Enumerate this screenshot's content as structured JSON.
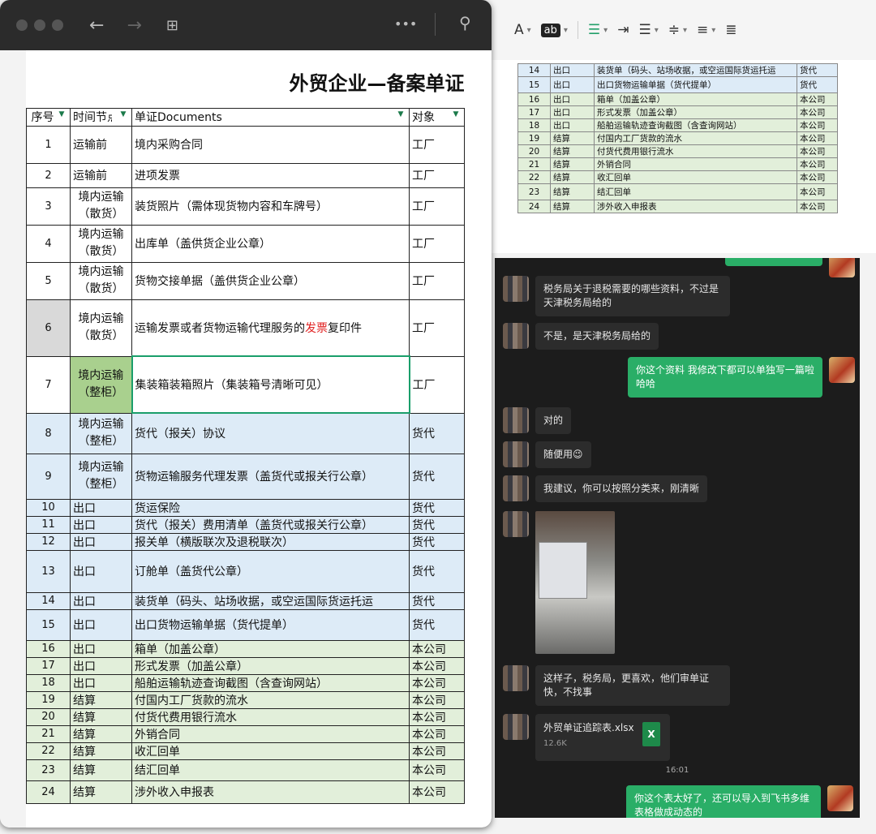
{
  "toolbar": {
    "font": "A",
    "ab": "ab"
  },
  "sheet": {
    "title": "外贸企业—备案单证",
    "headers": [
      "序号",
      "时间节点",
      "单证Documents",
      "对象"
    ],
    "rows": [
      {
        "n": "1",
        "t": "运输前",
        "d": "境内采购合同",
        "o": "工厂"
      },
      {
        "n": "2",
        "t": "运输前",
        "d": "进项发票",
        "o": "工厂"
      },
      {
        "n": "3",
        "t": "境内运输（散货）",
        "d": "装货照片（需体现货物内容和车牌号）",
        "o": "工厂"
      },
      {
        "n": "4",
        "t": "境内运输（散货）",
        "d": "出库单（盖供货企业公章）",
        "o": "工厂"
      },
      {
        "n": "5",
        "t": "境内运输（散货）",
        "d": "货物交接单据（盖供货企业公章）",
        "o": "工厂"
      },
      {
        "n": "6",
        "t": "境内运输（散货）",
        "d_pre": "运输发票或者货物运输代理服务的",
        "d_red": "发票",
        "d_post": "复印件",
        "o": "工厂"
      },
      {
        "n": "7",
        "t": "境内运输（整柜）",
        "d": "集装箱装箱照片（集装箱号清晰可见）",
        "o": "工厂"
      },
      {
        "n": "8",
        "t": "境内运输（整柜）",
        "d": "货代（报关）协议",
        "o": "货代"
      },
      {
        "n": "9",
        "t": "境内运输（整柜）",
        "d": "货物运输服务代理发票（盖货代或报关行公章）",
        "o": "货代"
      },
      {
        "n": "10",
        "t": "出口",
        "d": "货运保险",
        "o": "货代"
      },
      {
        "n": "11",
        "t": "出口",
        "d": "货代（报关）费用清单（盖货代或报关行公章）",
        "o": "货代"
      },
      {
        "n": "12",
        "t": "出口",
        "d": "报关单（横版联次及退税联次）",
        "o": "货代"
      },
      {
        "n": "13",
        "t": "出口",
        "d": "订舱单（盖货代公章）",
        "o": "货代"
      },
      {
        "n": "14",
        "t": "出口",
        "d": "装货单（码头、站场收据，或空运国际货运托运",
        "o": "货代"
      },
      {
        "n": "15",
        "t": "出口",
        "d": "出口货物运输单据（货代提单）",
        "o": "货代"
      },
      {
        "n": "16",
        "t": "出口",
        "d": "箱单（加盖公章）",
        "o": "本公司"
      },
      {
        "n": "17",
        "t": "出口",
        "d": "形式发票（加盖公章）",
        "o": "本公司"
      },
      {
        "n": "18",
        "t": "出口",
        "d": "船舶运输轨迹查询截图（含查询网站）",
        "o": "本公司"
      },
      {
        "n": "19",
        "t": "结算",
        "d": "付国内工厂货款的流水",
        "o": "本公司"
      },
      {
        "n": "20",
        "t": "结算",
        "d": "付货代费用银行流水",
        "o": "本公司"
      },
      {
        "n": "21",
        "t": "结算",
        "d": "外销合同",
        "o": "本公司"
      },
      {
        "n": "22",
        "t": "结算",
        "d": "收汇回单",
        "o": "本公司"
      },
      {
        "n": "23",
        "t": "结算",
        "d": "结汇回单",
        "o": "本公司"
      },
      {
        "n": "24",
        "t": "结算",
        "d": "涉外收入申报表",
        "o": "本公司"
      }
    ]
  },
  "doc": {
    "rows": [
      {
        "n": "14",
        "t": "出口",
        "d": "装货单（码头、站场收据，或空运国际货运托运",
        "o": "货代"
      },
      {
        "n": "15",
        "t": "出口",
        "d": "出口货物运输单据（货代提单）",
        "o": "货代"
      },
      {
        "n": "16",
        "t": "出口",
        "d": "箱单（加盖公章）",
        "o": "本公司"
      },
      {
        "n": "17",
        "t": "出口",
        "d": "形式发票（加盖公章）",
        "o": "本公司"
      },
      {
        "n": "18",
        "t": "出口",
        "d": "船舶运输轨迹查询截图（含查询网站）",
        "o": "本公司"
      },
      {
        "n": "19",
        "t": "结算",
        "d": "付国内工厂货款的流水",
        "o": "本公司"
      },
      {
        "n": "20",
        "t": "结算",
        "d": "付货代费用银行流水",
        "o": "本公司"
      },
      {
        "n": "21",
        "t": "结算",
        "d": "外销合同",
        "o": "本公司"
      },
      {
        "n": "22",
        "t": "结算",
        "d": "收汇回单",
        "o": "本公司"
      },
      {
        "n": "23",
        "t": "结算",
        "d": "结汇回单",
        "o": "本公司"
      },
      {
        "n": "24",
        "t": "结算",
        "d": "涉外收入申报表",
        "o": "本公司"
      }
    ]
  },
  "chat": {
    "m1": "税务局关于退税需要的哪些资料，不过是天津税务局给的",
    "m2": "不是，是天津税务局给的",
    "m3": "你这个资料 我修改下都可以单独写一篇啦 哈哈",
    "m4": "对的",
    "m5": "随便用😉",
    "m6": "我建议，你可以按照分类来，刚清晰",
    "m7": "这样子，税务局，更喜欢，他们审单证快，不找事",
    "file_name": "外贸单证追踪表.xlsx",
    "file_size": "12.6K",
    "file_icon": "X",
    "time": "16:01",
    "m8": "你这个表太好了，还可以导入到飞书多维表格做成动态的"
  }
}
